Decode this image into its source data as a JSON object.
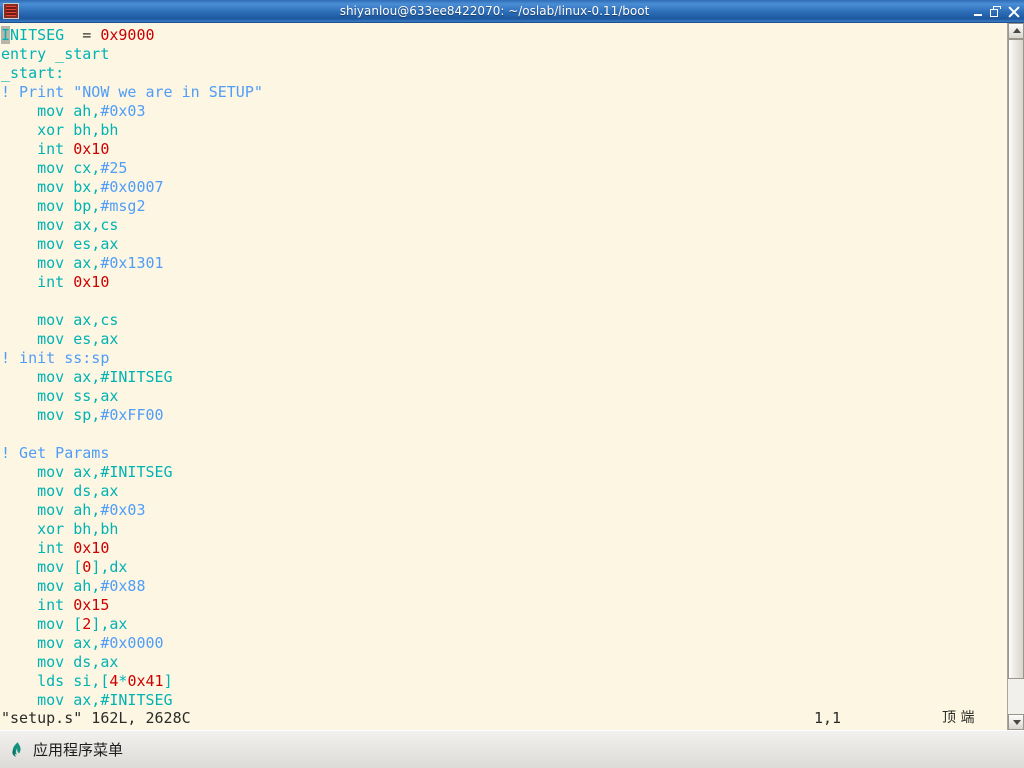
{
  "window": {
    "title": "shiyanlou@633ee8422070: ~/oslab/linux-0.11/boot",
    "icon": "terminal-icon",
    "controls": {
      "minimize": "minimize-button",
      "restore": "restore-button",
      "close": "close-button"
    }
  },
  "colors": {
    "background": "#fdf6e3",
    "cyan": "#00b3b3",
    "blue": "#4f9df7",
    "red": "#cc0000",
    "titlebar": "#2e6fba",
    "cursor": "#b8b4a8",
    "taskbar_icon": "#13917e"
  },
  "editor": {
    "lines": [
      [
        {
          "t": "I",
          "c": "cursor"
        },
        {
          "t": "NITSEG",
          "c": "cyan"
        },
        {
          "t": "  = ",
          "c": "black"
        },
        {
          "t": "0x9000",
          "c": "red"
        }
      ],
      [
        {
          "t": "entry _start",
          "c": "cyan"
        }
      ],
      [
        {
          "t": "_start:",
          "c": "cyan"
        }
      ],
      [
        {
          "t": "! Print \"NOW we are in SETUP\"",
          "c": "blue"
        }
      ],
      [
        {
          "t": "    mov ah,",
          "c": "cyan"
        },
        {
          "t": "#0x03",
          "c": "blue"
        }
      ],
      [
        {
          "t": "    xor bh,bh",
          "c": "cyan"
        }
      ],
      [
        {
          "t": "    int ",
          "c": "cyan"
        },
        {
          "t": "0x10",
          "c": "red"
        }
      ],
      [
        {
          "t": "    mov cx,",
          "c": "cyan"
        },
        {
          "t": "#25",
          "c": "blue"
        }
      ],
      [
        {
          "t": "    mov bx,",
          "c": "cyan"
        },
        {
          "t": "#0x0007",
          "c": "blue"
        }
      ],
      [
        {
          "t": "    mov bp,",
          "c": "cyan"
        },
        {
          "t": "#msg2",
          "c": "blue"
        }
      ],
      [
        {
          "t": "    mov ax,cs",
          "c": "cyan"
        }
      ],
      [
        {
          "t": "    mov es,ax",
          "c": "cyan"
        }
      ],
      [
        {
          "t": "    mov ax,",
          "c": "cyan"
        },
        {
          "t": "#0x1301",
          "c": "blue"
        }
      ],
      [
        {
          "t": "    int ",
          "c": "cyan"
        },
        {
          "t": "0x10",
          "c": "red"
        }
      ],
      [],
      [
        {
          "t": "    mov ax,cs",
          "c": "cyan"
        }
      ],
      [
        {
          "t": "    mov es,ax",
          "c": "cyan"
        }
      ],
      [
        {
          "t": "! init ss:sp",
          "c": "blue"
        }
      ],
      [
        {
          "t": "    mov ax,#INITSEG",
          "c": "cyan"
        }
      ],
      [
        {
          "t": "    mov ss,ax",
          "c": "cyan"
        }
      ],
      [
        {
          "t": "    mov sp,",
          "c": "cyan"
        },
        {
          "t": "#0xFF00",
          "c": "blue"
        }
      ],
      [],
      [
        {
          "t": "! Get Params",
          "c": "blue"
        }
      ],
      [
        {
          "t": "    mov ax,#INITSEG",
          "c": "cyan"
        }
      ],
      [
        {
          "t": "    mov ds,ax",
          "c": "cyan"
        }
      ],
      [
        {
          "t": "    mov ah,",
          "c": "cyan"
        },
        {
          "t": "#0x03",
          "c": "blue"
        }
      ],
      [
        {
          "t": "    xor bh,bh",
          "c": "cyan"
        }
      ],
      [
        {
          "t": "    int ",
          "c": "cyan"
        },
        {
          "t": "0x10",
          "c": "red"
        }
      ],
      [
        {
          "t": "    mov [",
          "c": "cyan"
        },
        {
          "t": "0",
          "c": "red"
        },
        {
          "t": "],dx",
          "c": "cyan"
        }
      ],
      [
        {
          "t": "    mov ah,",
          "c": "cyan"
        },
        {
          "t": "#0x88",
          "c": "blue"
        }
      ],
      [
        {
          "t": "    int ",
          "c": "cyan"
        },
        {
          "t": "0x15",
          "c": "red"
        }
      ],
      [
        {
          "t": "    mov [",
          "c": "cyan"
        },
        {
          "t": "2",
          "c": "red"
        },
        {
          "t": "],ax",
          "c": "cyan"
        }
      ],
      [
        {
          "t": "    mov ax,",
          "c": "cyan"
        },
        {
          "t": "#0x0000",
          "c": "blue"
        }
      ],
      [
        {
          "t": "    mov ds,ax",
          "c": "cyan"
        }
      ],
      [
        {
          "t": "    lds si,[",
          "c": "cyan"
        },
        {
          "t": "4",
          "c": "red"
        },
        {
          "t": "*",
          "c": "cyan"
        },
        {
          "t": "0x41",
          "c": "red"
        },
        {
          "t": "]",
          "c": "cyan"
        }
      ],
      [
        {
          "t": "    mov ax,#INITSEG",
          "c": "cyan"
        }
      ]
    ]
  },
  "statusline": {
    "file": "\"setup.s\" 162L, 2628C",
    "position": "1,1",
    "percent": "顶 端"
  },
  "scrollbar": {
    "up_arrow": "scroll-up-arrow",
    "down_arrow": "scroll-down-arrow"
  },
  "taskbar": {
    "items": [
      {
        "label": "应用程序菜单",
        "icon": "app-menu-icon"
      }
    ]
  }
}
